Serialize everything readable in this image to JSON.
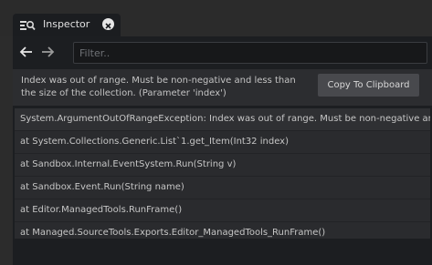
{
  "tab": {
    "title": "Inspector",
    "icon": "inspector-list-icon",
    "close_icon": "close-icon"
  },
  "toolbar": {
    "back_icon": "arrow-left-icon",
    "forward_icon": "arrow-right-icon",
    "filter_placeholder": "Filter..",
    "filter_value": ""
  },
  "message": {
    "text": "Index was out of range. Must be non-negative and less than the size of the collection. (Parameter 'index')",
    "copy_button_label": "Copy To Clipboard"
  },
  "stack_trace": [
    "System.ArgumentOutOfRangeException: Index was out of range. Must be non-negative and less than the size of the collection.",
    "at System.Collections.Generic.List`1.get_Item(Int32 index)",
    "at Sandbox.Internal.EventSystem.Run(String v)",
    "at Sandbox.Event.Run(String name)",
    "at Editor.ManagedTools.RunFrame()",
    "at Managed.SourceTools.Exports.Editor_ManagedTools_RunFrame()"
  ],
  "colors": {
    "panel_bg": "#1c1e21",
    "message_bg": "#2c2d30",
    "button_bg": "#48494d"
  }
}
